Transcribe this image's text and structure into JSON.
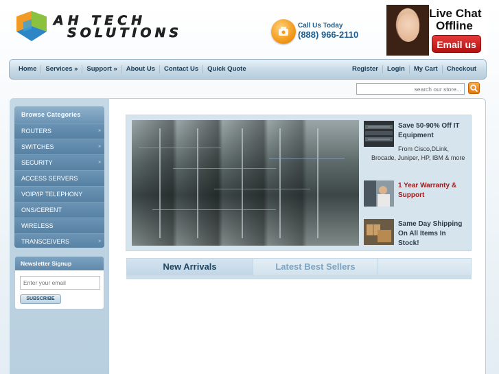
{
  "brand": {
    "line1": "AH TECH",
    "line2": "SOLUTIONS"
  },
  "contact": {
    "label": "Call Us Today",
    "number": "(888) 966-2110"
  },
  "livechat": {
    "title_line1": "Live Chat",
    "title_line2": "Offline",
    "email_button": "Email us"
  },
  "nav": {
    "left": [
      "Home",
      "Services »",
      "Support »",
      "About Us",
      "Contact Us",
      "Quick Quote"
    ],
    "right": [
      "Register",
      "Login",
      "My Cart",
      "Checkout"
    ]
  },
  "search": {
    "placeholder": "search our store..."
  },
  "categories": {
    "header": "Browse Categories",
    "items": [
      {
        "label": "ROUTERS",
        "arrow": "»"
      },
      {
        "label": "SWITCHES",
        "arrow": "»"
      },
      {
        "label": "SECURITY",
        "arrow": "»"
      },
      {
        "label": "ACCESS SERVERS",
        "arrow": ""
      },
      {
        "label": "VOIP/IP TELEPHONY",
        "arrow": ""
      },
      {
        "label": "ONS/CERENT",
        "arrow": ""
      },
      {
        "label": "WIRELESS",
        "arrow": ""
      },
      {
        "label": "TRANSCEIVERS",
        "arrow": "»"
      }
    ]
  },
  "newsletter": {
    "header": "Newsletter Signup",
    "placeholder": "Enter your email",
    "button": "SUBSCRIBE"
  },
  "promos": [
    {
      "title": "Save 50-90% Off IT Equipment",
      "desc_line1": "From Cisco,DLink,",
      "desc_rest": "Brocade, Juniper, HP, IBM & more"
    },
    {
      "title": "1 Year Warranty & Support"
    },
    {
      "title": "Same Day Shipping On All Items In Stock!"
    }
  ],
  "tabs": [
    "New Arrivals",
    "Latest Best Sellers"
  ],
  "colors": {
    "accent_blue": "#1b5d8e",
    "nav_bg": "#c9dbe7",
    "category_bg": "#5a86a8",
    "promo_red": "#a11b1b",
    "orange": "#f39a1c"
  }
}
